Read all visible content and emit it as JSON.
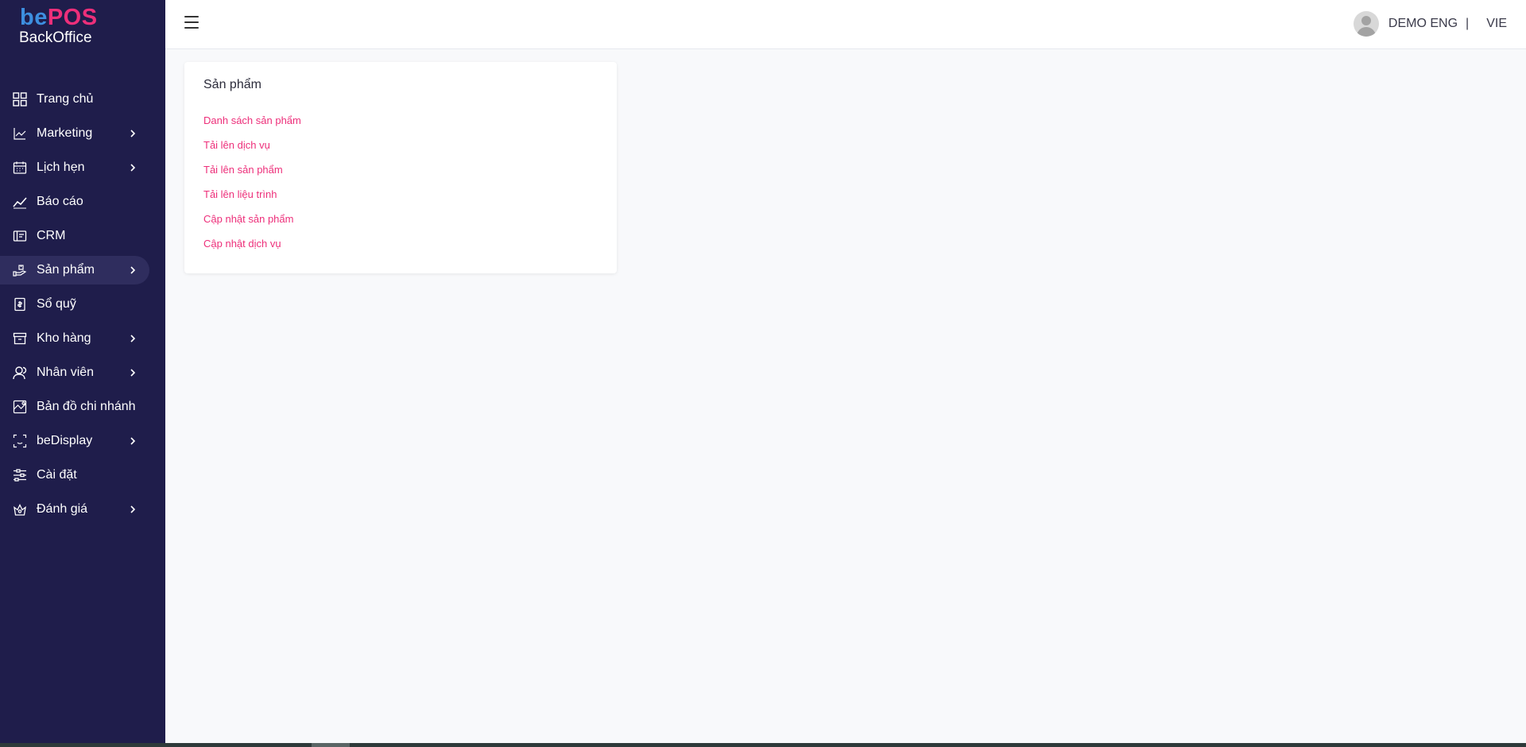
{
  "brand": {
    "logo_be": "be",
    "logo_pos": "POS",
    "logo_sub": "BackOffice"
  },
  "sidebar": {
    "items": [
      {
        "label": "Trang chủ",
        "icon": "grid-icon",
        "has_submenu": false,
        "active": false
      },
      {
        "label": "Marketing",
        "icon": "line-chart-icon",
        "has_submenu": true,
        "active": false
      },
      {
        "label": "Lịch hẹn",
        "icon": "calendar-icon",
        "has_submenu": true,
        "active": false
      },
      {
        "label": "Báo cáo",
        "icon": "trend-icon",
        "has_submenu": false,
        "active": false
      },
      {
        "label": "CRM",
        "icon": "crm-icon",
        "has_submenu": false,
        "active": false
      },
      {
        "label": "Sản phẩm",
        "icon": "product-icon",
        "has_submenu": true,
        "active": true
      },
      {
        "label": "Sổ quỹ",
        "icon": "ledger-icon",
        "has_submenu": false,
        "active": false
      },
      {
        "label": "Kho hàng",
        "icon": "warehouse-icon",
        "has_submenu": true,
        "active": false
      },
      {
        "label": "Nhân viên",
        "icon": "staff-icon",
        "has_submenu": true,
        "active": false
      },
      {
        "label": "Bản đồ chi nhánh",
        "icon": "map-icon",
        "has_submenu": false,
        "active": false
      },
      {
        "label": "beDisplay",
        "icon": "scan-icon",
        "has_submenu": true,
        "active": false
      },
      {
        "label": "Cài đặt",
        "icon": "settings-sliders-icon",
        "has_submenu": false,
        "active": false
      },
      {
        "label": "Đánh giá",
        "icon": "rating-icon",
        "has_submenu": true,
        "active": false
      }
    ]
  },
  "header": {
    "user_name": "DEMO ENG",
    "separator": "|",
    "language": "VIE"
  },
  "card": {
    "title": "Sản phẩm",
    "links": [
      "Danh sách sản phẩm",
      "Tải lên dịch vụ",
      "Tải lên sản phẩm",
      "Tải lên liệu trình",
      "Cập nhật sản phẩm",
      "Cập nhật dịch vụ"
    ]
  },
  "colors": {
    "sidebar_bg": "#1f1d4b",
    "sidebar_active": "#2f2d5e",
    "accent_pink": "#ed2f7a",
    "accent_blue": "#3d8fe0",
    "page_bg": "#f8f9fb"
  }
}
